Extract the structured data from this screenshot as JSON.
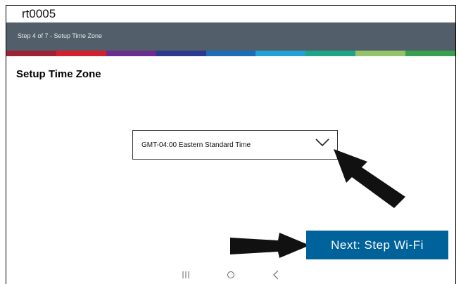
{
  "window": {
    "title": "rt0005"
  },
  "wizard": {
    "step_text": "Step 4 of 7 - Setup Time Zone",
    "strip_colors": [
      "#9e2236",
      "#d3202e",
      "#6a2d8e",
      "#2b3a8f",
      "#1c6db5",
      "#21a2d4",
      "#1fa487",
      "#94c36a",
      "#38a04e"
    ]
  },
  "page": {
    "title": "Setup Time Zone"
  },
  "timezone": {
    "selected": "GMT-04:00 Eastern Standard Time"
  },
  "actions": {
    "next_label": "Next: Step Wi-Fi"
  },
  "navigation": {
    "icons": [
      "recent-apps-icon",
      "home-icon",
      "back-icon"
    ]
  },
  "colors": {
    "header": "#525e69",
    "button": "#00629a"
  }
}
